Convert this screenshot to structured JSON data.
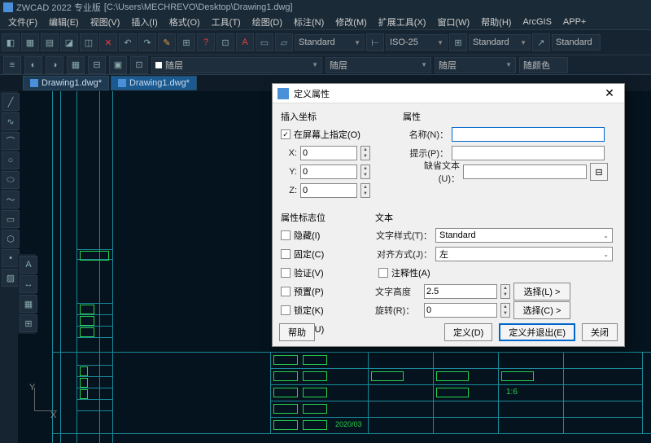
{
  "title": {
    "app": "ZWCAD 2022 专业版",
    "path": "[C:\\Users\\MECHREVO\\Desktop\\Drawing1.dwg]"
  },
  "menu": {
    "file": "文件(F)",
    "edit": "编辑(E)",
    "view": "视图(V)",
    "insert": "插入(I)",
    "format": "格式(O)",
    "tools": "工具(T)",
    "draw": "绘图(D)",
    "dim": "标注(N)",
    "modify": "修改(M)",
    "ext": "扩展工具(X)",
    "window": "窗口(W)",
    "help": "帮助(H)",
    "arcgis": "ArcGIS",
    "app": "APP+"
  },
  "combos": {
    "style": "Standard",
    "iso": "ISO-25",
    "style2": "Standard",
    "style3": "Standard",
    "layer": "随层",
    "layer2": "随层",
    "layer3": "随层",
    "layercolor": "随颜色"
  },
  "tabs": {
    "t1": "Drawing1.dwg*",
    "t2": "Drawing1.dwg*"
  },
  "dlg": {
    "title": "定义属性",
    "grp_insert": "插入坐标",
    "onscreen": "在屏幕上指定(O)",
    "x": "X:",
    "y": "Y:",
    "z": "Z:",
    "xval": "0",
    "yval": "0",
    "zval": "0",
    "grp_attr": "属性",
    "name": "名称(N)：",
    "prompt": "提示(P)：",
    "default": "缺省文本(U)：",
    "grp_flags": "属性标志位",
    "hidden": "隐藏(I)",
    "fixed": "固定(C)",
    "verify": "验证(V)",
    "preset": "预置(P)",
    "lock": "锁定(K)",
    "multi": "多行(U)",
    "grp_text": "文本",
    "txtstyle": "文字样式(T)：",
    "txtstyle_v": "Standard",
    "align": "对齐方式(J)：",
    "align_v": "左",
    "annot": "注释性(A)",
    "height": "文字高度",
    "height_v": "2.5",
    "height_btn": "选择(L) >",
    "rot": "旋转(R)：",
    "rot_v": "0",
    "rot_btn": "选择(C) >",
    "help": "帮助",
    "define": "定义(D)",
    "defexit": "定义并退出(E)",
    "close": "关闭"
  },
  "canvas": {
    "ratio": "1:6",
    "date": "2020/03"
  },
  "axis": {
    "y": "Y",
    "x": "X"
  }
}
